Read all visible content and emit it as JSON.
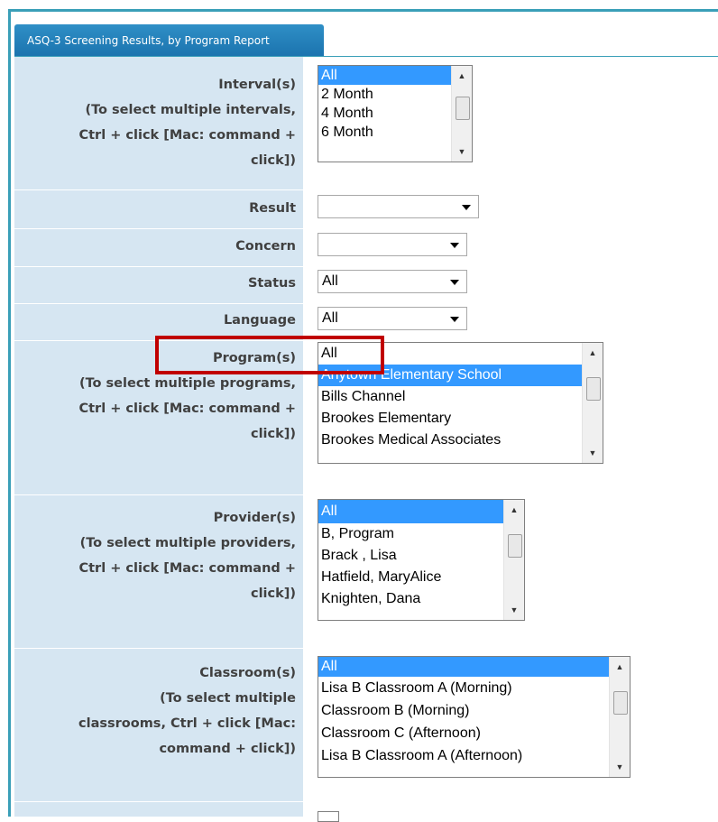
{
  "tab": {
    "title": "ASQ-3 Screening Results, by Program Report"
  },
  "fields": {
    "intervals": {
      "label": "Interval(s)",
      "hint_lines": [
        "(To select multiple intervals,",
        "Ctrl + click [Mac: command +",
        "click])"
      ],
      "options": [
        "All",
        "2 Month",
        "4 Month",
        "6 Month"
      ],
      "selected": "All"
    },
    "result": {
      "label": "Result",
      "value": ""
    },
    "concern": {
      "label": "Concern",
      "value": ""
    },
    "status": {
      "label": "Status",
      "value": "All"
    },
    "language": {
      "label": "Language",
      "value": "All"
    },
    "programs": {
      "label": "Program(s)",
      "hint_lines": [
        "(To select multiple programs,",
        "Ctrl + click [Mac: command +",
        "click])"
      ],
      "options": [
        "All",
        "Anytown Elementary School",
        "Bills Channel",
        "Brookes Elementary",
        "Brookes Medical Associates"
      ],
      "selected": "Anytown Elementary School"
    },
    "providers": {
      "label": "Provider(s)",
      "hint_lines": [
        "(To select multiple providers,",
        "Ctrl + click [Mac: command +",
        "click])"
      ],
      "options": [
        "All",
        "B, Program",
        "Brack , Lisa",
        "Hatfield, MaryAlice",
        "Knighten, Dana"
      ],
      "selected": "All"
    },
    "classrooms": {
      "label": "Classroom(s)",
      "hint_lines": [
        "(To select multiple",
        "classrooms, Ctrl + click [Mac:",
        "command + click])"
      ],
      "options": [
        "All",
        "Lisa B Classroom A (Morning)",
        "Classroom B (Morning)",
        "Classroom C (Afternoon)",
        "Lisa B Classroom A (Afternoon)"
      ],
      "selected": "All"
    }
  },
  "colors": {
    "frame": "#3a9fb8",
    "tab": "#1b73ae",
    "label_bg": "#d6e6f2",
    "selection": "#3399ff",
    "highlight": "#c00000"
  }
}
